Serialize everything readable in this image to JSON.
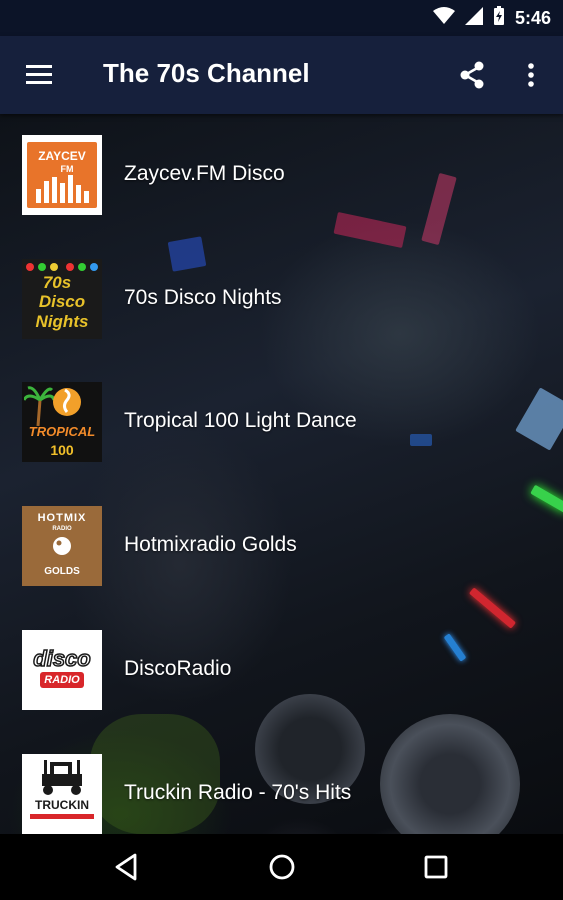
{
  "status_bar": {
    "time": "5:46",
    "icons": [
      "wifi-icon",
      "cellular-signal-icon",
      "battery-charging-icon"
    ]
  },
  "app_bar": {
    "title": "The 70s Channel",
    "icons": [
      "menu-icon",
      "share-icon",
      "more-vert-icon"
    ]
  },
  "stations": [
    {
      "name": "Zaycev.FM Disco",
      "logo": {
        "line1": "ZAYCEV",
        "line2": "FM",
        "colors": [
          "#e8742a",
          "#ffffff"
        ]
      }
    },
    {
      "name": "70s Disco Nights",
      "logo": {
        "line1": "70s",
        "line2": "Disco",
        "line3": "Nights",
        "colors": [
          "#1a1a1a",
          "#e8c22a"
        ]
      }
    },
    {
      "name": "Tropical 100 Light Dance",
      "logo": {
        "line1": "TROPICAL",
        "line2": "100",
        "colors": [
          "#1a1a1a",
          "#f28b2a"
        ]
      }
    },
    {
      "name": "Hotmixradio Golds",
      "logo": {
        "line1": "HOTMIX",
        "line2": "RADIO",
        "line3": "GOLDS",
        "colors": [
          "#9a6a3a",
          "#ffffff"
        ]
      }
    },
    {
      "name": "DiscoRadio",
      "logo": {
        "line1": "disco",
        "line2": "RADIO",
        "colors": [
          "#ffffff",
          "#d8262a"
        ]
      }
    },
    {
      "name": "Truckin Radio - 70's Hits",
      "logo": {
        "line1": "TRUCKIN",
        "colors": [
          "#ffffff",
          "#1a1a1a"
        ]
      }
    }
  ],
  "nav_bar": {
    "icons": [
      "back-icon",
      "home-icon",
      "recents-icon"
    ]
  },
  "colors": {
    "status_bar": "#0c1428",
    "app_bar": "#16203c",
    "nav_bar": "#000000",
    "text": "#ffffff"
  }
}
